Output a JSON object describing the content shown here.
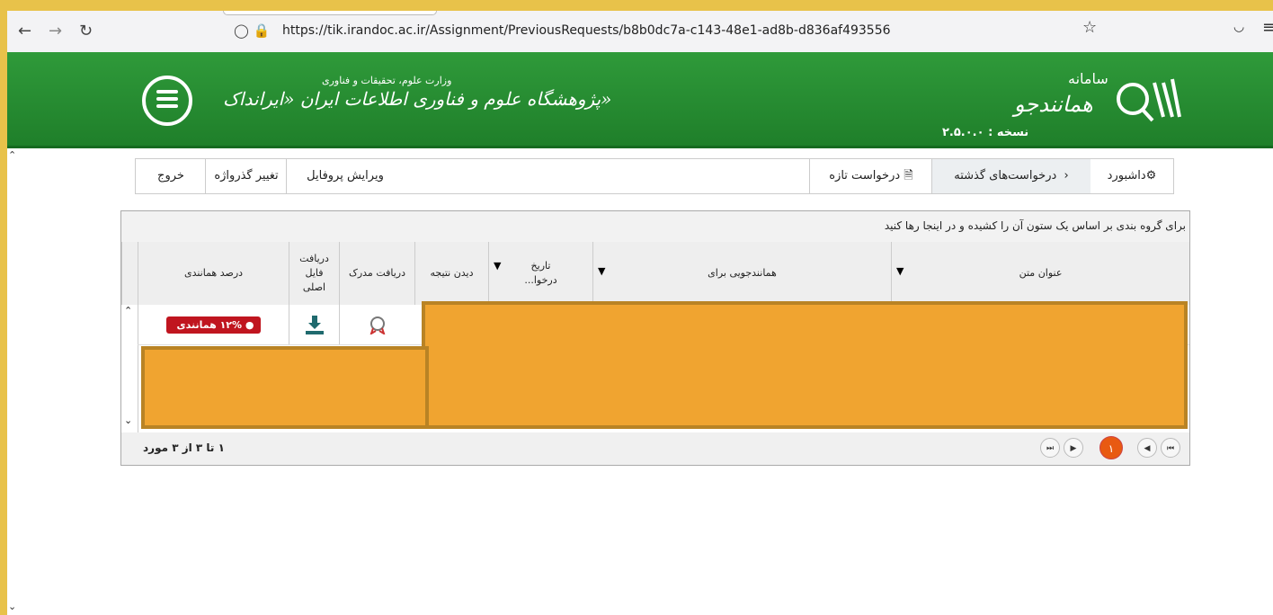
{
  "browser": {
    "back": "←",
    "forward": "→",
    "reload": "↻",
    "url": "https://tik.irandoc.ac.ir/Assignment/PreviousRequests/b8b0dc7a-c143-48e1-ad8b-d836af493556",
    "url_icons": "◯ 🔒",
    "star": "☆",
    "pocket": "◡",
    "menu": "≡"
  },
  "header": {
    "institute_sub": "وزارت علوم، تحقیقات و فناوری",
    "institute_main": "پژوهشگاه علوم و فناوری اطلاعات ایران «ایرانداک»",
    "system_label": "سامانه",
    "system_name": "همانندجو",
    "version": "نسخه : ۲.۵.۰.۰"
  },
  "nav": {
    "dashboard": "داشبورد",
    "previous_requests": "درخواست‌های گذشته",
    "new_request": "درخواست تازه",
    "edit_profile": "ویرایش پروفایل",
    "change_password": "تغییر گذرواژه",
    "logout": "خروج"
  },
  "grid": {
    "group_hint": "برای گروه بندی بر اساس یک ستون آن را کشیده و در اینجا رها کنید",
    "columns": {
      "title": "عنوان متن",
      "check_for": "همانندجویی برای",
      "request_date": "تاریخ درخوا...",
      "view_result": "دیدن نتیجه",
      "get_document": "دریافت مدرک",
      "get_original": "دریافت فایل اصلی",
      "similarity": "درصد همانندی"
    },
    "row1": {
      "similarity_badge": "۱۲% همانندی"
    },
    "pager": {
      "first": "⏮",
      "prev": "◀",
      "current": "۱",
      "next": "▶",
      "last": "⏭"
    },
    "count_info": "۱ تا ۳ از ۳ مورد"
  },
  "colors": {
    "header_green": "#2f9a3a",
    "badge_red": "#c0151f",
    "redaction": "#f0a430",
    "pager_active": "#e85a12"
  }
}
